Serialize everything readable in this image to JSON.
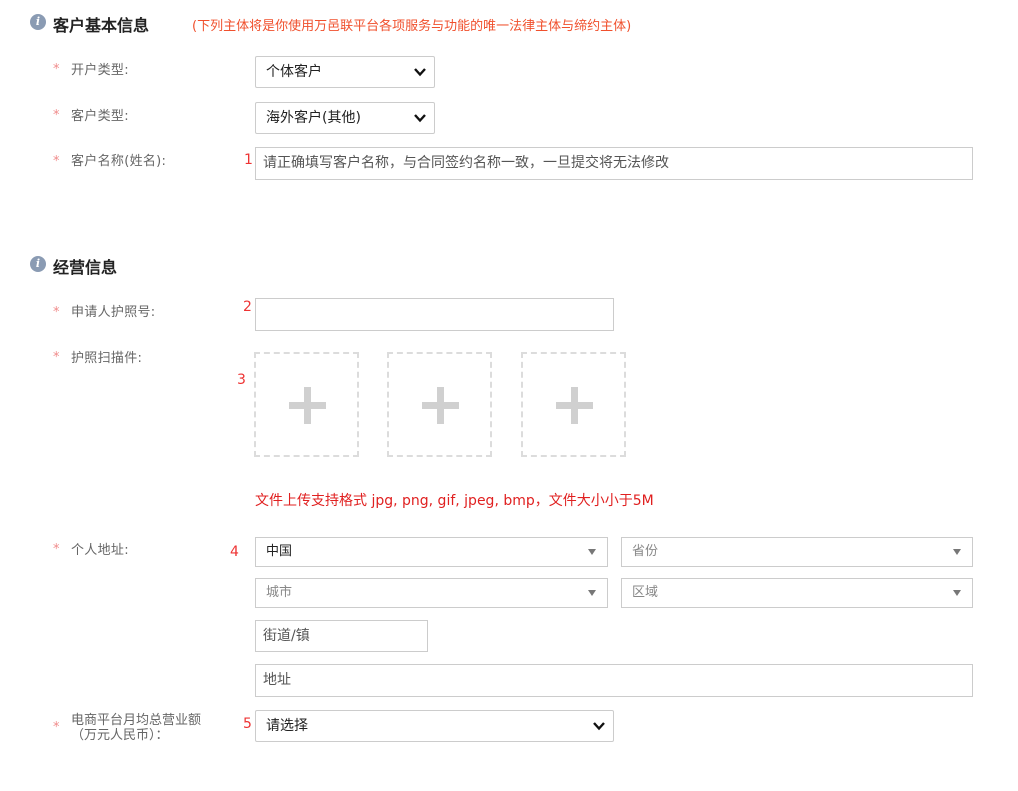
{
  "section1": {
    "icon": "info-icon",
    "title": "客户基本信息",
    "note": "(下列主体将是你使用万邑联平台各项服务与功能的唯一法律主体与缔约主体)"
  },
  "fields1": {
    "required_mark": "*",
    "account_type": {
      "label": "开户类型:",
      "value": "个体客户"
    },
    "customer_type": {
      "label": "客户类型:",
      "value": "海外客户(其他)"
    },
    "customer_name": {
      "label": "客户名称(姓名):",
      "number": "1",
      "placeholder": "请正确填写客户名称，与合同签约名称一致，一旦提交将无法修改"
    }
  },
  "section2": {
    "icon": "info-icon",
    "title": "经营信息"
  },
  "fields2": {
    "passport_no": {
      "label": "申请人护照号:",
      "number": "2",
      "value": ""
    },
    "passport_scan": {
      "label": "护照扫描件:",
      "number": "3",
      "upload_icon": "plus-icon",
      "hint": "文件上传支持格式 jpg, png, gif, jpeg, bmp，文件大小小于5M"
    },
    "address": {
      "label": "个人地址:",
      "number": "4",
      "country": "中国",
      "province": "省份",
      "city": "城市",
      "district": "区域",
      "street": "街道/镇",
      "detail": "地址"
    },
    "revenue": {
      "label_line1": "电商平台月均总营业额",
      "label_line2": "（万元人民币）：",
      "number": "5",
      "value": "请选择"
    }
  },
  "colors": {
    "accent_red": "#e02020",
    "note_orange": "#f0502d",
    "border": "#cccccc"
  }
}
